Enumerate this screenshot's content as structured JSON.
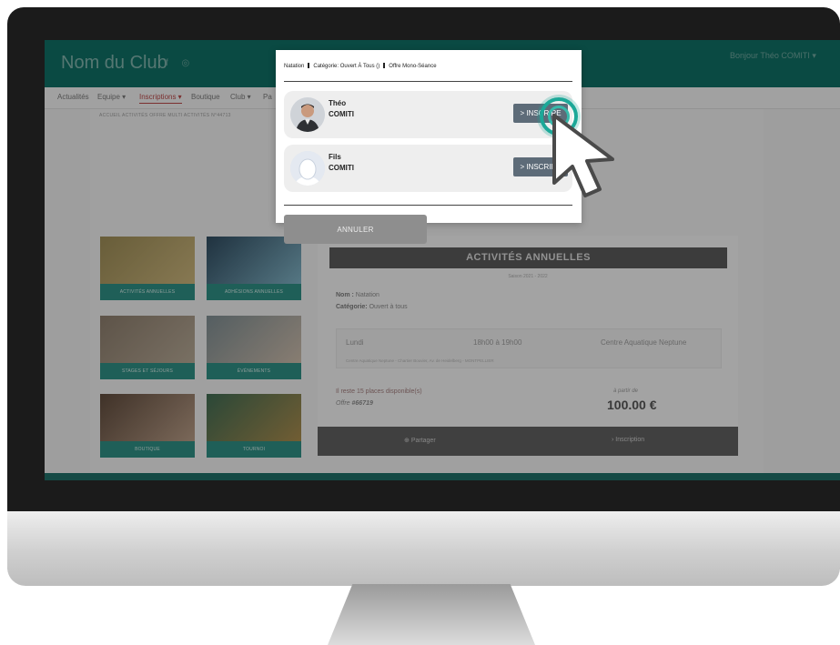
{
  "site": {
    "club_name": "Nom du Club",
    "social_icons": "f ◎",
    "user_menu": "Bonjour Théo COMITI ▾",
    "nav": [
      "Actualités",
      "Equipe ▾",
      "Inscriptions ▾",
      "Boutique",
      "Club ▾",
      "Pa"
    ],
    "breadcrumb": "ACCUEIL   ACTIVITÉS   OFFRE MULTI ACTIVITÉS N°44713"
  },
  "tiles": [
    {
      "label": "ACTIVITÉS ANNUELLES",
      "colors": [
        "#9a8a55",
        "#c7b27a"
      ]
    },
    {
      "label": "ADHÉSIONS ANNUELLES",
      "colors": [
        "#2f4a5e",
        "#7eb0c2"
      ]
    },
    {
      "label": "STAGES ET SÉJOURS",
      "colors": [
        "#8a7b6b",
        "#b3a693"
      ]
    },
    {
      "label": "ÉVÉNEMENTS",
      "colors": [
        "#7c8b90",
        "#c9b9a8"
      ]
    },
    {
      "label": "BOUTIQUE",
      "colors": [
        "#5e4a3c",
        "#b59a84"
      ]
    },
    {
      "label": "TOURNOI",
      "colors": [
        "#3f6a52",
        "#a88a4c"
      ]
    }
  ],
  "card": {
    "title": "ACTIVITÉS ANNUELLES",
    "season": "Saison 2021 - 2022",
    "nom_label": "Nom :",
    "nom_value": "Natation",
    "categorie_label": "Catégorie:",
    "categorie_value": "Ouvert à tous",
    "day": "Lundi",
    "hours": "18h00 à 19h00",
    "venue": "Centre Aquatique Neptune",
    "address": "Centre Aquatique Neptune - Chartier Bouvier, Av. de Heidelberg - MONTPELLIER",
    "places": "Il reste 15 places disponible(s)",
    "offre_label": "Offre",
    "offre_value": "#66719",
    "apartir": "à partir de",
    "price": "100.00 €",
    "share": "Partager",
    "inscription": "Inscription"
  },
  "modal": {
    "crumbs": [
      "Natation",
      "Catégorie: Ouvert À Tous ()",
      "Offre Mono-Séance"
    ],
    "members": [
      {
        "first": "Théo",
        "last": "COMITI",
        "button": "> INSCRIRE"
      },
      {
        "first": "Fils",
        "last": "COMITI",
        "button": "> INSCRIRE"
      }
    ],
    "cancel": "ANNULER"
  },
  "colors": {
    "header": "#0f6d63",
    "accent": "#1ca898",
    "button": "#5d6b78"
  }
}
